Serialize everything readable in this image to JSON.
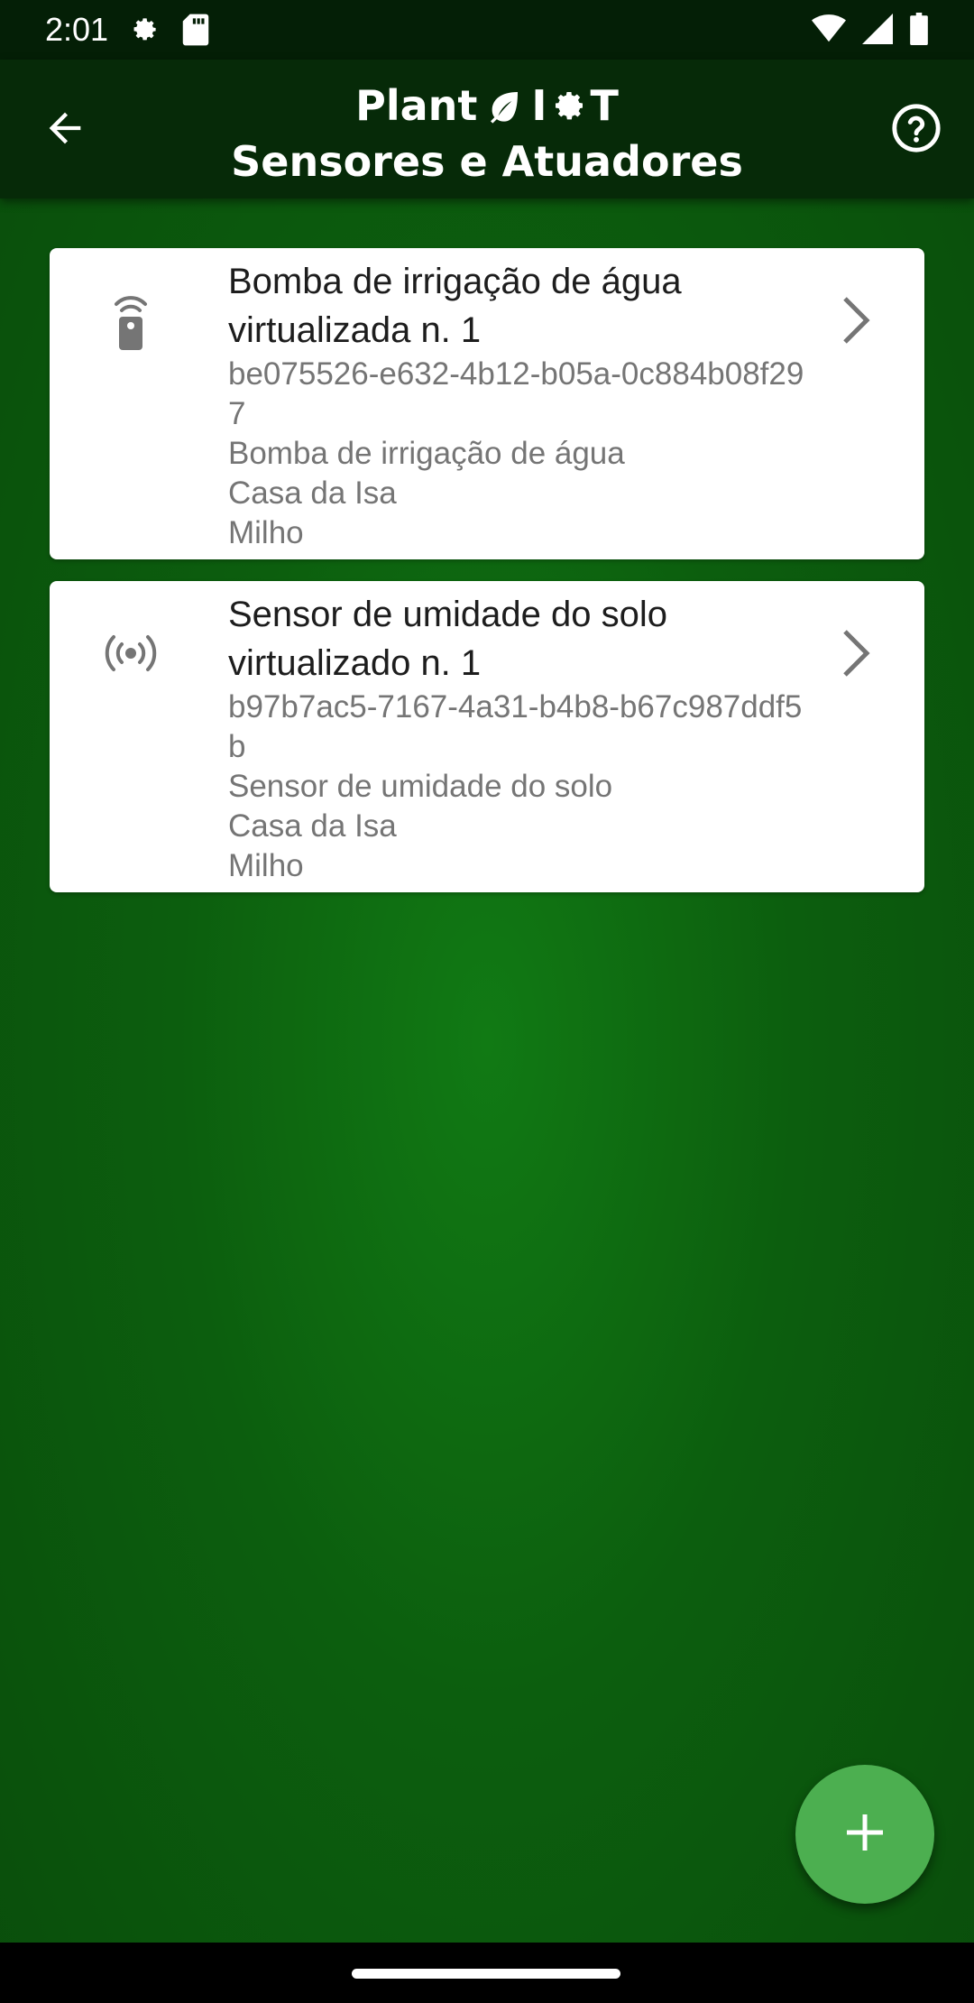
{
  "status_bar": {
    "time": "2:01",
    "icons": [
      "settings-gear-icon",
      "sd-card-icon",
      "wifi-icon",
      "cellular-signal-icon",
      "battery-icon"
    ]
  },
  "app_bar": {
    "title_line1_part1": "Plant",
    "title_line1_part2": "I",
    "title_line1_part3": "T",
    "title_line2": "Sensores e Atuadores",
    "icons": [
      "back-arrow-icon",
      "help-circle-icon",
      "leaf-icon",
      "gear-icon"
    ]
  },
  "devices": [
    {
      "icon": "remote-control-icon",
      "title": "Bomba de irrigação de água virtualizada n. 1",
      "id": "be075526-e632-4b12-b05a-0c884b08f297",
      "type": "Bomba de irrigação de água",
      "location": "Casa da Isa",
      "crop": "Milho"
    },
    {
      "icon": "sensor-waves-icon",
      "title": "Sensor de umidade do solo virtualizado n. 1",
      "id": "b97b7ac5-7167-4a31-b4b8-b67c987ddf5b",
      "type": "Sensor de umidade do solo",
      "location": "Casa da Isa",
      "crop": "Milho"
    }
  ],
  "fab": {
    "icon": "plus-icon",
    "color": "#4caf50"
  },
  "colors": {
    "background": "#0c5e0e",
    "app_bar": "#062a08",
    "card": "#ffffff",
    "title_text": "#1d1d1d",
    "subtitle_text": "#757575"
  }
}
